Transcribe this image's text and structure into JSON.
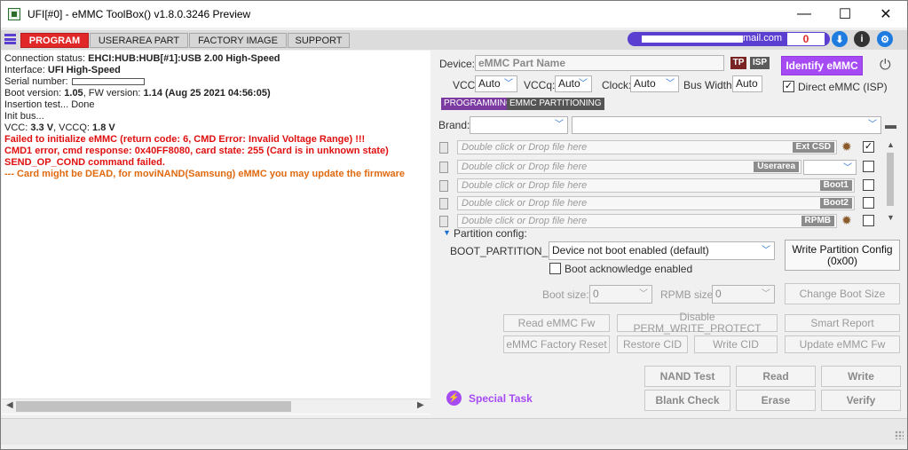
{
  "window": {
    "title": "UFI[#0] - eMMC ToolBox() v1.8.0.3246 Preview",
    "minimize": "—",
    "maximize": "☐",
    "close": "✕"
  },
  "tabs": [
    {
      "label": "PROGRAM",
      "active": true
    },
    {
      "label": "USERAREA PART",
      "active": false
    },
    {
      "label": "FACTORY IMAGE",
      "active": false
    },
    {
      "label": "SUPPORT",
      "active": false
    }
  ],
  "account": {
    "email_suffix": "mail.com",
    "counter": "0"
  },
  "log": {
    "l1_label": "Connection status: ",
    "l1_value": "EHCI:HUB:HUB[#1]:USB 2.00 High-Speed",
    "l2_label": "Interface: ",
    "l2_value": "UFI High-Speed",
    "l3_label": "Serial number:",
    "l4_label": " Boot version: ",
    "l4_value": "1.05",
    "l4_label2": ", FW version: ",
    "l4_value2": "1.14 (Aug 25 2021 04:56:05)",
    "l5": "Insertion test... Done",
    "l6": "Init bus...",
    "l7_label": "VCC: ",
    "l7_value": "3.3 V",
    "l7_label2": ", VCCQ: ",
    "l7_value2": "1.8 V",
    "l8": "Failed to initialize eMMC (return code: 6, CMD Error: Invalid Voltage Range) !!!",
    "l9": " CMD1 error, cmd response: 0x40FF8080, card state: 255 (Card is in unknown state)",
    "l10": " SEND_OP_COND command failed.",
    "l11": "--- Card might be DEAD, for moviNAND(Samsung) eMMC you may update the firmware"
  },
  "device": {
    "label": "Device:",
    "placeholder": "eMMC Part Name",
    "tp": "TP",
    "isp": "ISP",
    "identify": "Identify eMMC"
  },
  "power": {
    "vcc_label": "VCC:",
    "vcc_value": "Auto",
    "vccq_label": "VCCq:",
    "vccq_value": "Auto",
    "clock_label": "Clock:",
    "clock_value": "Auto",
    "bus_label": "Bus Width:",
    "bus_value": "Auto",
    "direct_label": "Direct eMMC (ISP)",
    "direct_checked": "✓"
  },
  "subtabs": [
    "PROGRAMMING",
    "EMMC PARTITIONING"
  ],
  "brand": {
    "label": "Brand:",
    "value": "",
    "model": ""
  },
  "files": [
    {
      "placeholder": "Double click or Drop file here",
      "tag": "Ext CSD",
      "check": "✓"
    },
    {
      "placeholder": "Double click or Drop file here",
      "tag": "Userarea",
      "check": ""
    },
    {
      "placeholder": "Double click or Drop file here",
      "tag": "Boot1",
      "check": ""
    },
    {
      "placeholder": "Double click or Drop file here",
      "tag": "Boot2",
      "check": ""
    },
    {
      "placeholder": "Double click or Drop file here",
      "tag": "RPMB",
      "check": ""
    }
  ],
  "partition": {
    "header": "Partition config:",
    "boot_label": "BOOT_PARTITION_EN",
    "boot_value": "Device not boot enabled (default)",
    "ack_label": "Boot acknowledge enabled",
    "write_btn": "Write Partition Config\n(0x00)",
    "boot_size_label": "Boot size:",
    "boot_size_value": "0",
    "rpmb_size_label": "RPMB size:",
    "rpmb_size_value": "0",
    "change_boot": "Change Boot Size"
  },
  "actions": {
    "read_fw": "Read eMMC Fw",
    "disable_perm": "Disable PERM_WRITE_PROTECT",
    "smart": "Smart Report",
    "factory_reset": "eMMC Factory Reset",
    "restore_cid": "Restore CID",
    "write_cid": "Write CID",
    "update_fw": "Update eMMC Fw",
    "nand_test": "NAND Test",
    "read": "Read",
    "write": "Write",
    "blank_check": "Blank Check",
    "erase": "Erase",
    "verify": "Verify",
    "special_task": "Special Task"
  },
  "colors": {
    "accent": "#5b3fd1",
    "program_tab": "#e12828",
    "error": "#e01010",
    "warning": "#e06a10",
    "identify_btn": "#a64bf4"
  }
}
